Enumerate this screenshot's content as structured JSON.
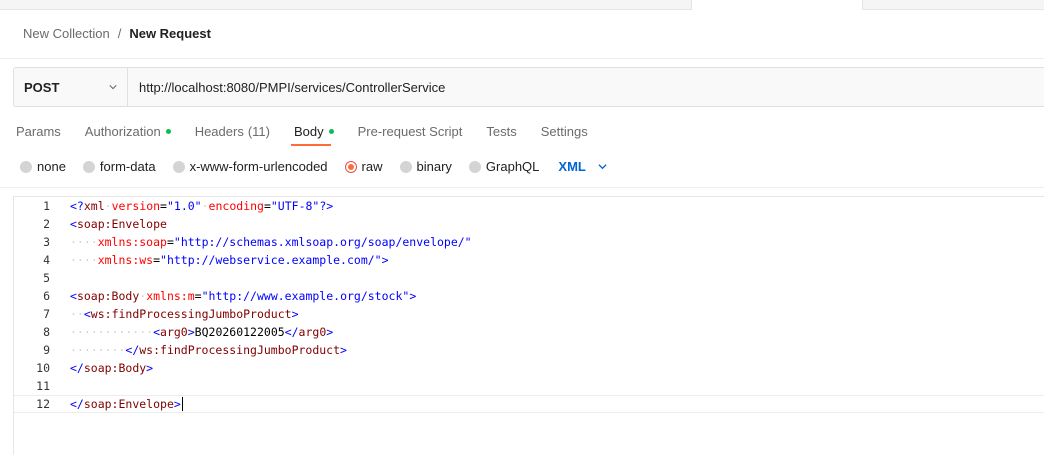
{
  "breadcrumb": {
    "parent": "New Collection",
    "separator": "/",
    "current": "New Request"
  },
  "request": {
    "method": "POST",
    "url": "http://localhost:8080/PMPI/services/ControllerService"
  },
  "tabs": [
    {
      "label": "Params",
      "dot": false
    },
    {
      "label": "Authorization",
      "dot": true
    },
    {
      "label": "Headers",
      "count": "(11)",
      "dot": false
    },
    {
      "label": "Body",
      "dot": true,
      "active": true
    },
    {
      "label": "Pre-request Script",
      "dot": false
    },
    {
      "label": "Tests",
      "dot": false
    },
    {
      "label": "Settings",
      "dot": false
    }
  ],
  "body_options": {
    "none": "none",
    "form_data": "form-data",
    "urlencoded": "x-www-form-urlencoded",
    "raw": "raw",
    "binary": "binary",
    "graphql": "GraphQL",
    "selected": "raw",
    "language": "XML"
  },
  "editor": {
    "line_numbers": [
      "1",
      "2",
      "3",
      "4",
      "5",
      "6",
      "7",
      "8",
      "9",
      "10",
      "11",
      "12"
    ],
    "lines": [
      "<?xml version=\"1.0\" encoding=\"UTF-8\"?>",
      "<soap:Envelope",
      "    xmlns:soap=\"http://schemas.xmlsoap.org/soap/envelope/\"",
      "    xmlns:ws=\"http://webservice.example.com/\">",
      "",
      "<soap:Body xmlns:m=\"http://www.example.org/stock\">",
      "  <ws:findProcessingJumboProduct>",
      "            <arg0>BQ20260122005</arg0>",
      "        </ws:findProcessingJumboProduct>",
      "</soap:Body>",
      "",
      "</soap:Envelope>"
    ]
  },
  "colors": {
    "accent": "#ff6c37",
    "dot_green": "#0cbb52",
    "link_blue": "#0265d2",
    "xml_tag": "#800000",
    "xml_attr": "#ff0000",
    "xml_value": "#0000ff"
  }
}
